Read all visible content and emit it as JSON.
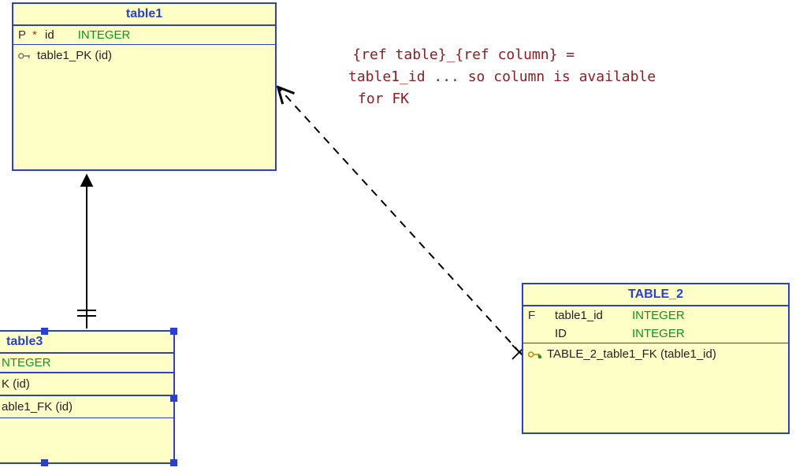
{
  "annotation": {
    "line1": "{ref table}_{ref column} =",
    "line2": "table1_id ... so column is available",
    "line3": "for FK"
  },
  "entities": {
    "table1": {
      "title": "table1",
      "columns": [
        {
          "flag": "P",
          "asterisk": "*",
          "name": "id",
          "type": "INTEGER"
        }
      ],
      "indexes": [
        {
          "icon": "pk-key",
          "label": "table1_PK (id)"
        }
      ]
    },
    "table2": {
      "title": "TABLE_2",
      "columns": [
        {
          "flag": "F",
          "asterisk": "",
          "name": "table1_id",
          "type": "INTEGER"
        },
        {
          "flag": "",
          "asterisk": "",
          "name": "ID",
          "type": "INTEGER"
        }
      ],
      "indexes": [
        {
          "icon": "fk-key",
          "label": "TABLE_2_table1_FK (table1_id)"
        }
      ]
    },
    "table3": {
      "title": "table3",
      "columns_fragment": [
        {
          "type_fragment": "NTEGER"
        }
      ],
      "index_fragments": [
        {
          "label_fragment": "K (id)"
        },
        {
          "label_fragment": "able1_FK (id)"
        }
      ]
    }
  },
  "relationships": [
    {
      "from": "table3",
      "to": "table1",
      "style": "solid",
      "kind": "identifying"
    },
    {
      "from": "TABLE_2",
      "to": "table1",
      "style": "dashed",
      "kind": "fk-optional"
    }
  ],
  "colors": {
    "entity_border": "#2b3fd4",
    "entity_fill": "#feffc7",
    "type_text": "#119120",
    "annotation_text": "#8f1d23"
  }
}
